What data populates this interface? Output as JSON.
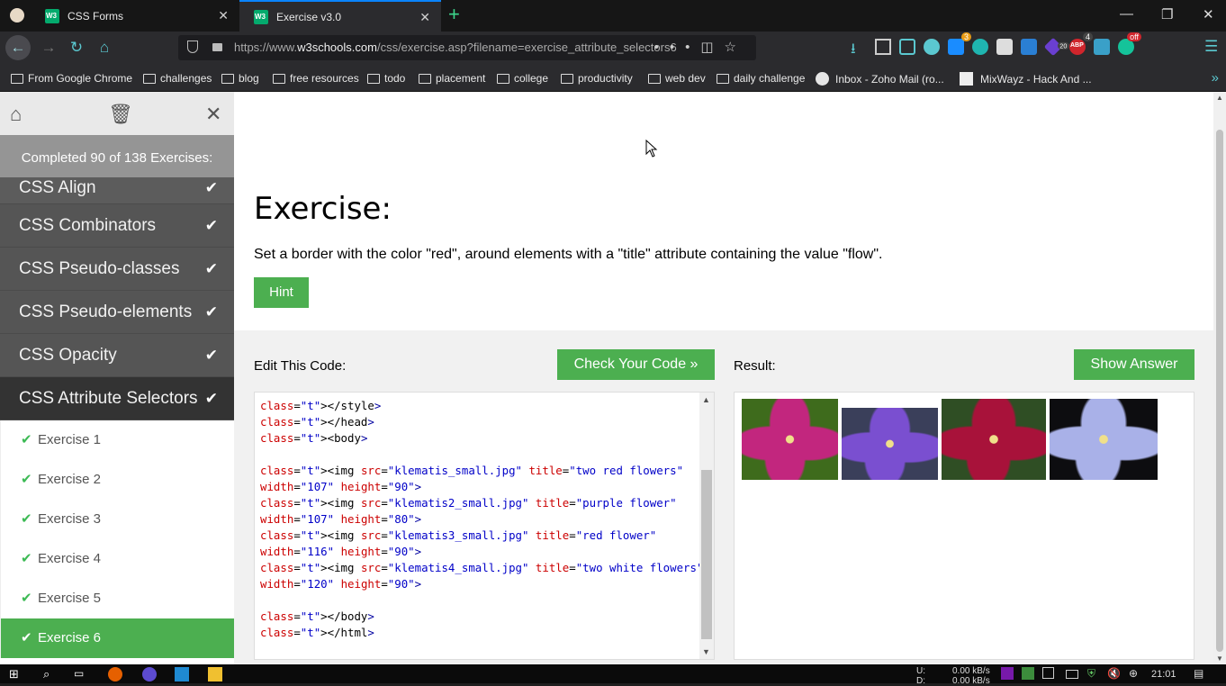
{
  "browser": {
    "tabs": [
      {
        "title": "CSS Forms",
        "active": false
      },
      {
        "title": "Exercise v3.0",
        "active": true
      }
    ],
    "url_prefix": "https://www.",
    "url_domain": "w3schools.com",
    "url_path": "/css/exercise.asp?filename=exercise_attribute_selectors6",
    "extension_badges": {
      "blue": "3",
      "purple": "20",
      "abp": "4",
      "abp_label": "ABP",
      "grammarly": "off"
    },
    "bookmarks": [
      "From Google Chrome",
      "challenges",
      "blog",
      "free resources",
      "todo",
      "placement",
      "college",
      "productivity",
      "web dev",
      "daily challenge",
      "Inbox - Zoho Mail (ro...",
      "MixWayz - Hack And ..."
    ]
  },
  "sidebar": {
    "completed_text": "Completed 90 of 138 Exercises:",
    "topics": [
      {
        "label": "CSS Align",
        "done": true
      },
      {
        "label": "CSS Combinators",
        "done": true
      },
      {
        "label": "CSS Pseudo-classes",
        "done": true
      },
      {
        "label": "CSS Pseudo-elements",
        "done": true
      },
      {
        "label": "CSS Opacity",
        "done": true
      },
      {
        "label": "CSS Attribute Selectors",
        "done": true
      }
    ],
    "exercises": [
      "Exercise 1",
      "Exercise 2",
      "Exercise 3",
      "Exercise 4",
      "Exercise 5",
      "Exercise 6"
    ],
    "active_exercise": "Exercise 6"
  },
  "exercise": {
    "heading": "Exercise:",
    "instruction": "Set a border with the color \"red\", around elements with a \"title\" attribute containing the value \"flow\".",
    "hint_label": "Hint",
    "edit_label": "Edit This Code:",
    "check_label": "Check Your Code »",
    "result_label": "Result:",
    "answer_label": "Show Answer"
  },
  "code_lines": [
    "</style>",
    "</head>",
    "<body>",
    "",
    "<img src=\"klematis_small.jpg\" title=\"two red flowers\"",
    "width=\"107\" height=\"90\">",
    "<img src=\"klematis2_small.jpg\" title=\"purple flower\"",
    "width=\"107\" height=\"80\">",
    "<img src=\"klematis3_small.jpg\" title=\"red flower\"",
    "width=\"116\" height=\"90\">",
    "<img src=\"klematis4_small.jpg\" title=\"two white flowers\"",
    "width=\"120\" height=\"90\">",
    "",
    "</body>",
    "</html>"
  ],
  "result_images": [
    {
      "title": "two red flowers",
      "bg": "#3e6b1c",
      "petal": "#c2267e"
    },
    {
      "title": "purple flower",
      "bg": "#3a3f5a",
      "petal": "#7a4fd0"
    },
    {
      "title": "red flower",
      "bg": "#2f4e24",
      "petal": "#a8123a"
    },
    {
      "title": "two white flowers",
      "bg": "#0d0d10",
      "petal": "#a9b1e8"
    }
  ],
  "taskbar": {
    "net_up_label": "U:",
    "net_down_label": "D:",
    "net_up": "0.00 kB/s",
    "net_down": "0.00 kB/s",
    "time": "21:01"
  }
}
